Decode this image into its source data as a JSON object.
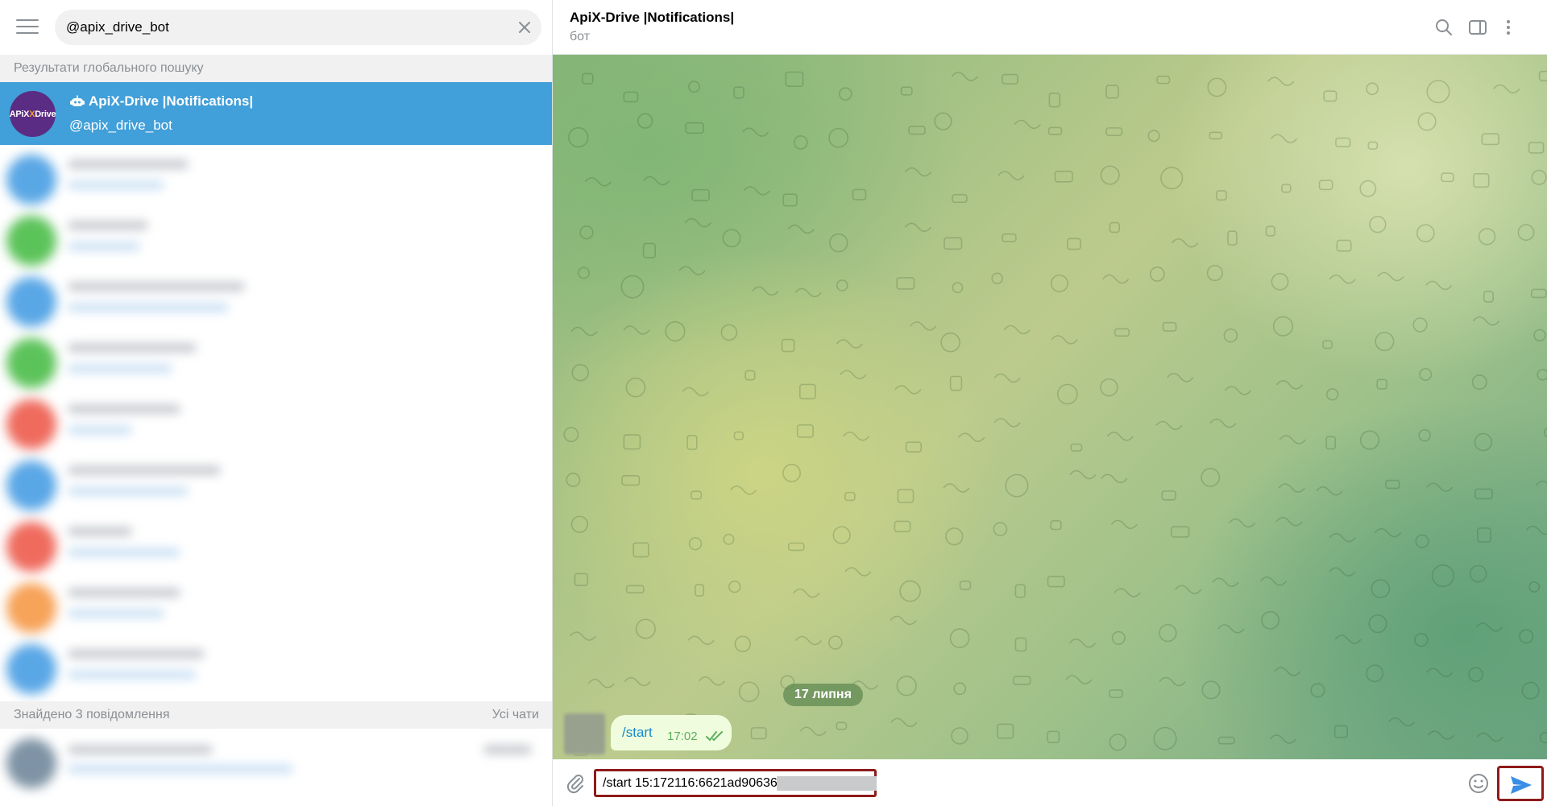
{
  "search": {
    "value": "@apix_drive_bot"
  },
  "sections": {
    "global_results": "Результати глобального пошуку",
    "found_messages": "Знайдено 3 повідомлення",
    "all_chats": "Усі чати"
  },
  "result": {
    "avatar_text_1": "APiX",
    "avatar_text_x": "X",
    "avatar_text_2": "Drive",
    "name": "ApiX-Drive |Notifications|",
    "handle": "@apix_drive_bot"
  },
  "chat": {
    "title": "ApiX-Drive |Notifications|",
    "subtitle": "бот",
    "date": "17 липня",
    "message": {
      "text": "/start",
      "time": "17:02"
    }
  },
  "composer": {
    "input_value": "/start 15:172116:6621ad9063695d5"
  },
  "colors": {
    "accent": "#419fd9",
    "highlight_frame": "#8e1b1b",
    "send": "#3a8ee6"
  }
}
